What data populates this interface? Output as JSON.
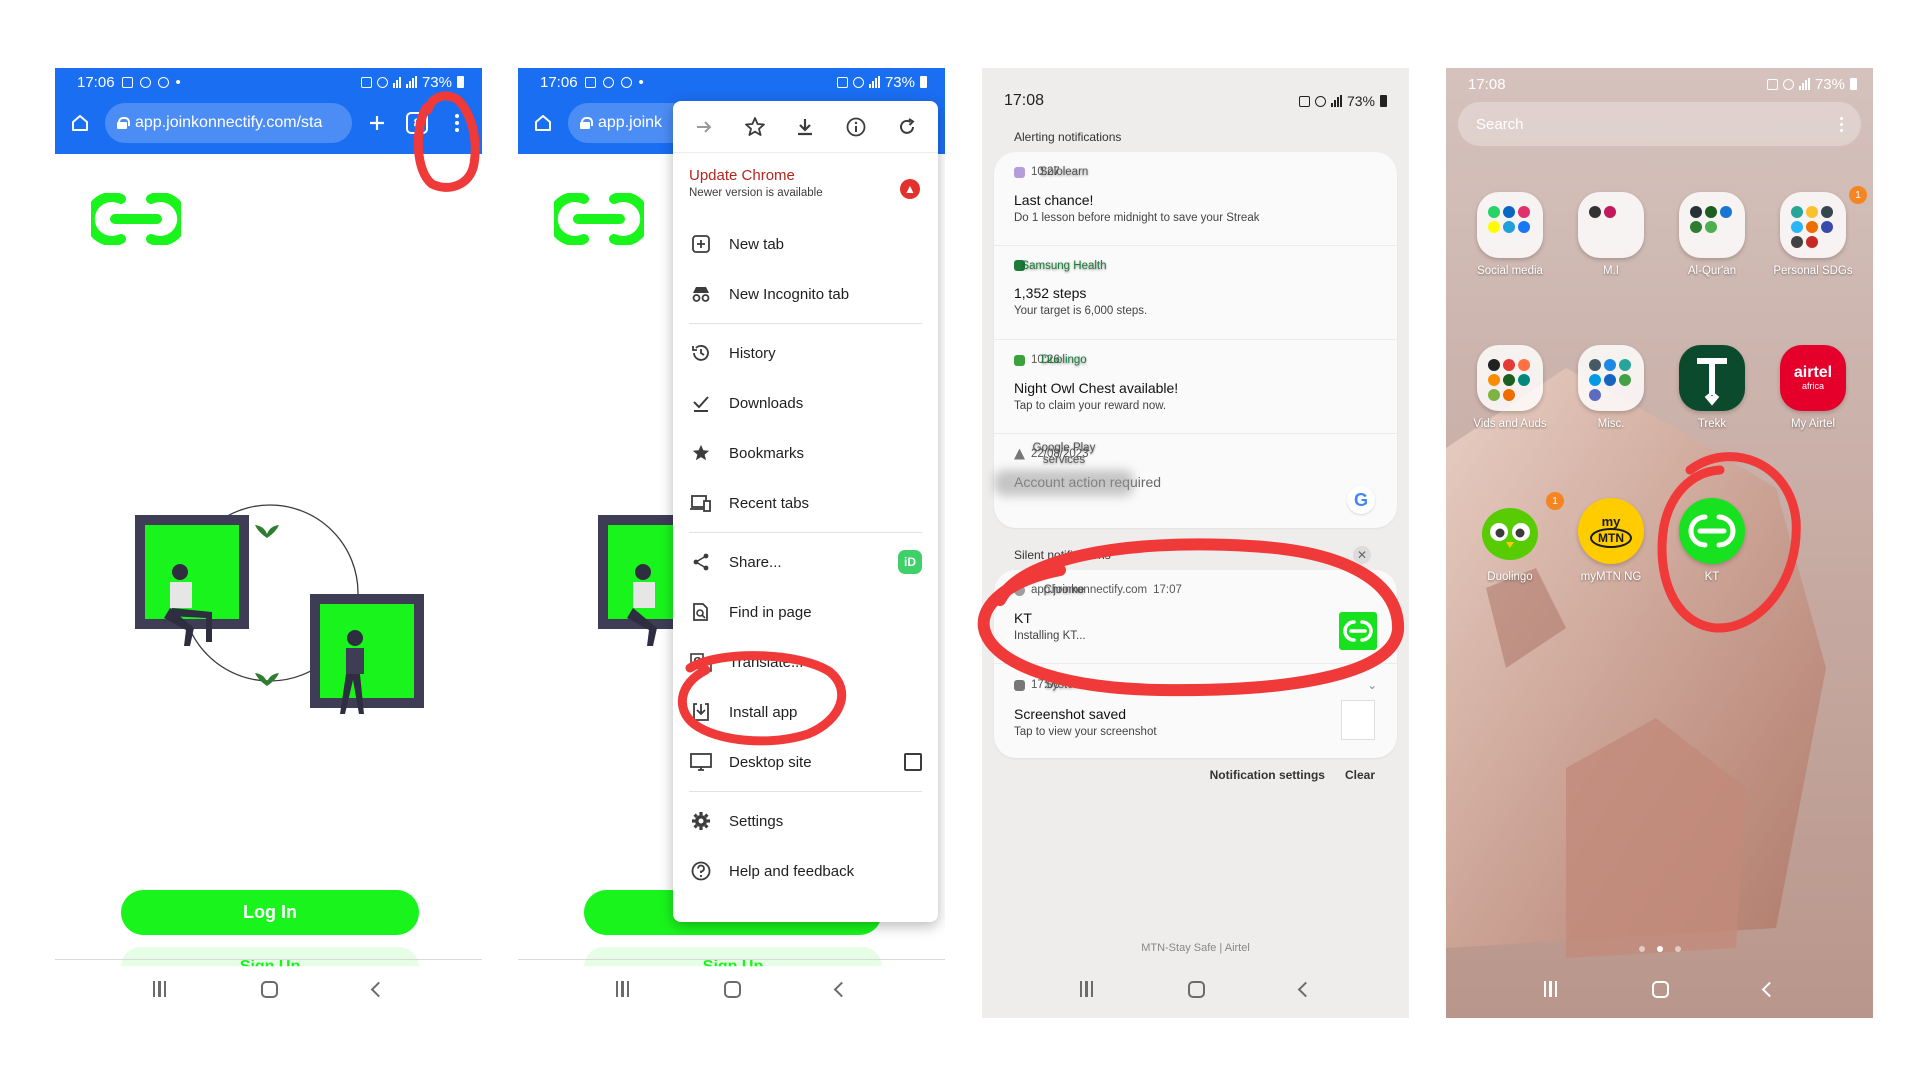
{
  "colors": {
    "chrome_blue": "#1a6ef2",
    "brand_green": "#19f51c",
    "annotation_red": "#f03a3a",
    "update_red": "#b3261e"
  },
  "panel1": {
    "status": {
      "time": "17:06",
      "battery": "73%"
    },
    "url": "app.joinkonnectify.com/sta",
    "tab_count": "8",
    "login_label": "Log In",
    "signup_label": "Sign Up"
  },
  "panel2": {
    "status": {
      "time": "17:06",
      "battery": "73%"
    },
    "url": "app.joink",
    "login_label": "Log In",
    "signup_label": "Sign Up",
    "menu": {
      "icon_row": [
        "forward-icon",
        "star-icon",
        "download-icon",
        "info-icon",
        "reload-icon"
      ],
      "update_title": "Update Chrome",
      "update_subtitle": "Newer version is available",
      "items": [
        {
          "label": "New tab",
          "icon": "plus-box-icon"
        },
        {
          "label": "New Incognito tab",
          "icon": "incognito-icon"
        },
        {
          "label": "History",
          "icon": "history-icon"
        },
        {
          "label": "Downloads",
          "icon": "download-check-icon"
        },
        {
          "label": "Bookmarks",
          "icon": "star-icon"
        },
        {
          "label": "Recent tabs",
          "icon": "devices-icon"
        },
        {
          "label": "Share...",
          "icon": "share-icon"
        },
        {
          "label": "Find in page",
          "icon": "find-icon"
        },
        {
          "label": "Translate...",
          "icon": "translate-icon"
        },
        {
          "label": "Install app",
          "icon": "install-icon"
        },
        {
          "label": "Desktop site",
          "icon": "monitor-icon"
        },
        {
          "label": "Settings",
          "icon": "gear-icon"
        },
        {
          "label": "Help and feedback",
          "icon": "help-icon"
        }
      ]
    }
  },
  "panel3": {
    "status": {
      "time": "17:08",
      "battery": "73%"
    },
    "alerting_label": "Alerting notifications",
    "silent_label": "Silent notifications",
    "alerting": [
      {
        "app": "Sololearn",
        "time": "10:27",
        "title": "Last chance!",
        "body": "Do 1 lesson before midnight to save your Streak"
      },
      {
        "app": "Samsung Health",
        "time": "",
        "title": "1,352 steps",
        "body": "Your target is 6,000 steps."
      },
      {
        "app": "Duolingo",
        "time": "10:26",
        "title": "Night Owl Chest available!",
        "body": "Tap to claim your reward now."
      },
      {
        "app": "Google Play services",
        "time": "22/08/2023",
        "title": "Account action required",
        "body": ""
      }
    ],
    "silent": [
      {
        "app": "Chrome",
        "source": "app.joinkonnectify.com",
        "time": "17:07",
        "title": "KT",
        "body": "Installing KT..."
      },
      {
        "app": "System",
        "source": "",
        "time": "17:06",
        "title": "Screenshot saved",
        "body": "Tap to view your screenshot"
      }
    ],
    "notification_settings": "Notification settings",
    "clear": "Clear",
    "carrier": "MTN-Stay Safe | Airtel"
  },
  "panel4": {
    "status": {
      "time": "17:08",
      "battery": "73%"
    },
    "search_placeholder": "Search",
    "apps": [
      {
        "label": "Social media",
        "badge": ""
      },
      {
        "label": "M.I",
        "badge": ""
      },
      {
        "label": "Al-Qur'an",
        "badge": ""
      },
      {
        "label": "Personal SDGs",
        "badge": "1"
      },
      {
        "label": "Vids and Auds",
        "badge": ""
      },
      {
        "label": "Misc.",
        "badge": ""
      },
      {
        "label": "Trekk",
        "badge": ""
      },
      {
        "label": "My Airtel",
        "badge": ""
      },
      {
        "label": "Duolingo",
        "badge": "1"
      },
      {
        "label": "myMTN NG",
        "badge": ""
      },
      {
        "label": "KT",
        "badge": ""
      }
    ],
    "airtel_text": "airtel",
    "airtel_sub": "africa",
    "mtn_my": "my",
    "mtn_text": "MTN",
    "page_dots": 3,
    "active_page": 2
  }
}
